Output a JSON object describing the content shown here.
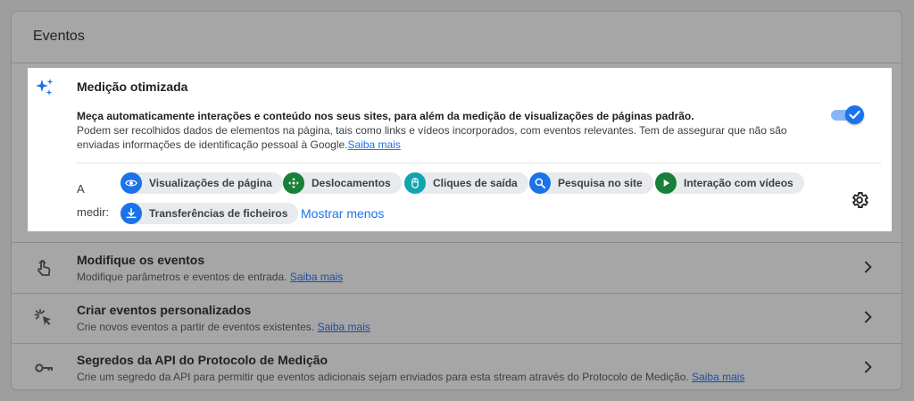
{
  "panel": {
    "title": "Eventos"
  },
  "enhanced": {
    "title": "Medição otimizada",
    "desc_strong": "Meça automaticamente interações e conteúdo nos seus sites, para além da medição de visualizações de páginas padrão.",
    "desc_text": "Podem ser recolhidos dados de elementos na página, tais como links e vídeos incorporados, com eventos relevantes. Tem de assegurar que não são enviadas informações de identificação pessoal à Google.",
    "learn_more": "Saiba mais",
    "toggle_on": true,
    "measure_label_1": "A",
    "measure_label_2": "medir:",
    "chips": [
      {
        "label": "Visualizações de página",
        "icon": "eye-icon",
        "color": "#1a73e8"
      },
      {
        "label": "Deslocamentos",
        "icon": "scroll-arrows-icon",
        "color": "#188038"
      },
      {
        "label": "Cliques de saída",
        "icon": "mouse-icon",
        "color": "#12a4af"
      },
      {
        "label": "Pesquisa no site",
        "icon": "search-icon",
        "color": "#1a73e8"
      },
      {
        "label": "Interação com vídeos",
        "icon": "play-icon",
        "color": "#188038"
      },
      {
        "label": "Transferências de ficheiros",
        "icon": "download-icon",
        "color": "#1a73e8"
      }
    ],
    "show_less": "Mostrar menos",
    "settings_icon": "gear-icon"
  },
  "rows": [
    {
      "title": "Modifique os eventos",
      "desc": "Modifique parâmetros e eventos de entrada.",
      "link": "Saiba mais",
      "icon": "touch-icon"
    },
    {
      "title": "Criar eventos personalizados",
      "desc": "Crie novos eventos a partir de eventos existentes.",
      "link": "Saiba mais",
      "icon": "cursor-sparkle-icon"
    },
    {
      "title": "Segredos da API do Protocolo de Medição",
      "desc": "Crie um segredo da API para permitir que eventos adicionais sejam enviados para esta stream através do Protocolo de Medição.",
      "link": "Saiba mais",
      "icon": "key-icon"
    }
  ],
  "colors": {
    "accent": "#1a73e8",
    "green": "#188038",
    "teal": "#12a4af",
    "overlay": "#9e9e9e"
  }
}
